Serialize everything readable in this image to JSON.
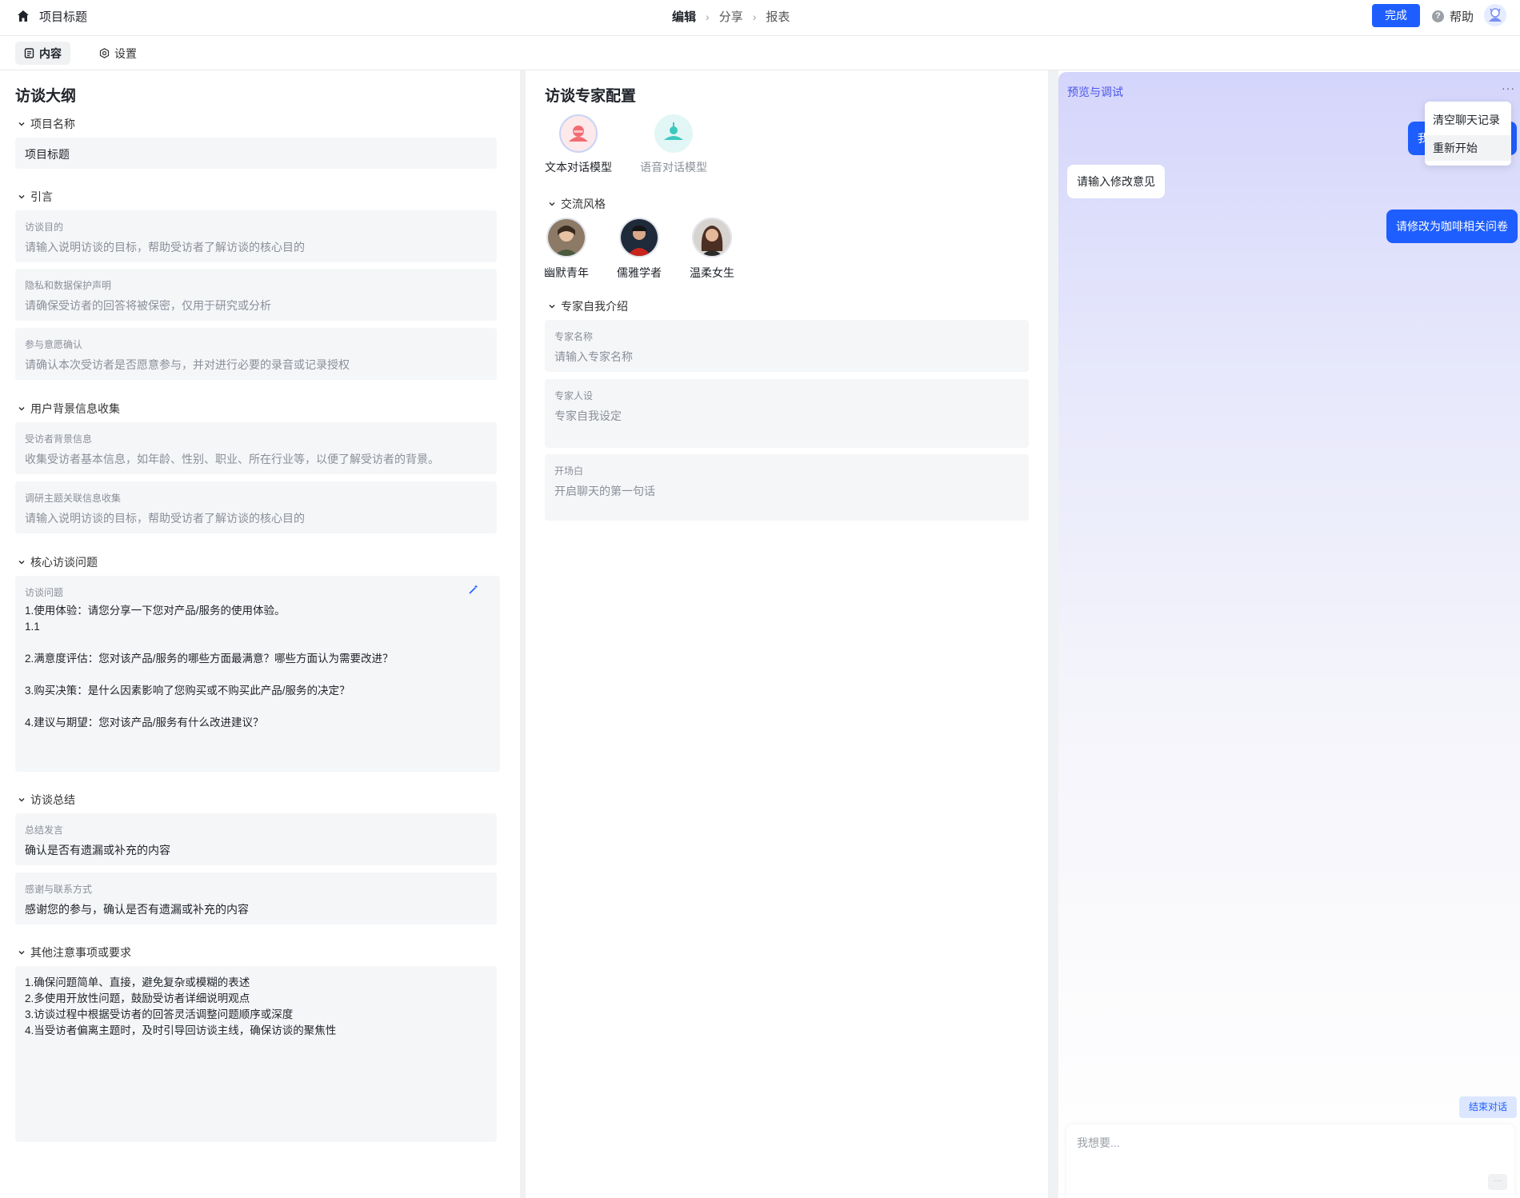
{
  "header": {
    "project_title": "项目标题",
    "steps": [
      "编辑",
      "分享",
      "报表"
    ],
    "done_label": "完成",
    "help_label": "帮助"
  },
  "tabs": [
    {
      "label": "内容",
      "active": true
    },
    {
      "label": "设置",
      "active": false
    }
  ],
  "outline": {
    "title": "访谈大纲",
    "project_name_section": "项目名称",
    "project_name_value": "项目标题",
    "intro_section": "引言",
    "intro_fields": [
      {
        "label": "访谈目的",
        "placeholder": "请输入说明访谈的目标，帮助受访者了解访谈的核心目的"
      },
      {
        "label": "隐私和数据保护声明",
        "placeholder": "请确保受访者的回答将被保密，仅用于研究或分析"
      },
      {
        "label": "参与意愿确认",
        "placeholder": "请确认本次受访者是否愿意参与，并对进行必要的录音或记录授权"
      }
    ],
    "background_section": "用户背景信息收集",
    "background_fields": [
      {
        "label": "受访者背景信息",
        "placeholder": "收集受访者基本信息，如年龄、性别、职业、所在行业等，以便了解受访者的背景。"
      },
      {
        "label": "调研主题关联信息收集",
        "placeholder": "请输入说明访谈的目标，帮助受访者了解访谈的核心目的"
      }
    ],
    "core_section": "核心访谈问题",
    "core_label": "访谈问题",
    "core_text": "1.使用体验：请您分享一下您对产品/服务的使用体验。\n1.1\n\n2.满意度评估：您对该产品/服务的哪些方面最满意？哪些方面认为需要改进？\n\n3.购买决策：是什么因素影响了您购买或不购买此产品/服务的决定？\n\n4.建议与期望：您对该产品/服务有什么改进建议？",
    "summary_section": "访谈总结",
    "summary_fields": [
      {
        "label": "总结发言",
        "value": "确认是否有遗漏或补充的内容"
      },
      {
        "label": "感谢与联系方式",
        "value": "感谢您的参与，确认是否有遗漏或补充的内容"
      }
    ],
    "notes_section": "其他注意事项或要求",
    "notes_text": "1.确保问题简单、直接，避免复杂或模糊的表述\n2.多使用开放性问题，鼓励受访者详细说明观点\n3.访谈过程中根据受访者的回答灵活调整问题顺序或深度\n4.当受访者偏离主题时，及时引导回访谈主线，确保访谈的聚焦性"
  },
  "expert": {
    "title": "访谈专家配置",
    "models": [
      {
        "label": "文本对话模型",
        "selected": true
      },
      {
        "label": "语音对话模型",
        "selected": false
      }
    ],
    "style_section": "交流风格",
    "personas": [
      "幽默青年",
      "儒雅学者",
      "温柔女生"
    ],
    "intro_section": "专家自我介绍",
    "fields": [
      {
        "label": "专家名称",
        "placeholder": "请输入专家名称"
      },
      {
        "label": "专家人设",
        "placeholder": "专家自我设定"
      },
      {
        "label": "开场白",
        "placeholder": "开启聊天的第一句话"
      }
    ]
  },
  "preview": {
    "title": "预览与调试",
    "messages": [
      {
        "role": "user",
        "text": "我"
      },
      {
        "role": "bot",
        "text": "请输入修改意见"
      },
      {
        "role": "user",
        "text": "请修改为咖啡相关问卷"
      }
    ],
    "menu": [
      "清空聊天记录",
      "重新开始"
    ],
    "end_label": "结束对话",
    "input_placeholder": "我想要..."
  },
  "colors": {
    "primary": "#1e5eff",
    "preview_title": "#4b56e8",
    "field_bg": "#f5f6f8"
  }
}
